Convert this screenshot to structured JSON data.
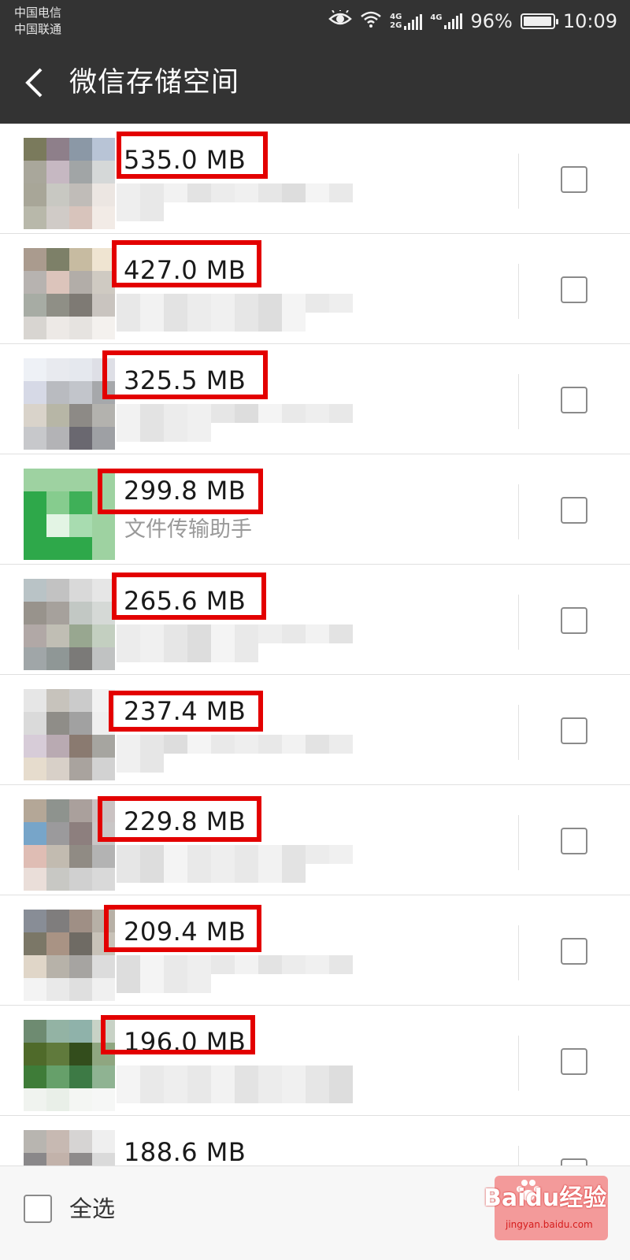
{
  "status_bar": {
    "carrier_1": "中国电信",
    "carrier_2": "中国联通",
    "sig_1_top": "4G",
    "sig_1_bottom": "2G",
    "sig_2_top": "4G",
    "battery_percent": "96%",
    "time": "10:09",
    "battery_level": 0.96,
    "icons": [
      "eye-icon",
      "wifi-icon",
      "cellular-signal-icon",
      "battery-icon"
    ]
  },
  "header": {
    "title": "微信存储空间",
    "back_icon": "chevron-left-icon"
  },
  "list": {
    "items": [
      {
        "size": "535.0 MB",
        "subtitle": "",
        "checked": false,
        "highlighted": true
      },
      {
        "size": "427.0 MB",
        "subtitle": "",
        "checked": false,
        "highlighted": true
      },
      {
        "size": "325.5 MB",
        "subtitle": "",
        "checked": false,
        "highlighted": true
      },
      {
        "size": "299.8 MB",
        "subtitle": "文件传输助手",
        "checked": false,
        "highlighted": true
      },
      {
        "size": "265.6 MB",
        "subtitle": "",
        "checked": false,
        "highlighted": true
      },
      {
        "size": "237.4 MB",
        "subtitle": "",
        "checked": false,
        "highlighted": true
      },
      {
        "size": "229.8 MB",
        "subtitle": "",
        "checked": false,
        "highlighted": true
      },
      {
        "size": "209.4 MB",
        "subtitle": "",
        "checked": false,
        "highlighted": true
      },
      {
        "size": "196.0 MB",
        "subtitle": "",
        "checked": false,
        "highlighted": true
      },
      {
        "size": "188.6 MB",
        "subtitle": "",
        "checked": false,
        "highlighted": false
      }
    ]
  },
  "footer": {
    "select_all_label": "全选",
    "select_all_checked": false,
    "watermark_main": "Baidu经验",
    "watermark_sub": "jingyan.baidu.com"
  },
  "colors": {
    "bar_background": "#333333",
    "highlight_border": "#e30000",
    "delete_button": "#f39a9a"
  }
}
